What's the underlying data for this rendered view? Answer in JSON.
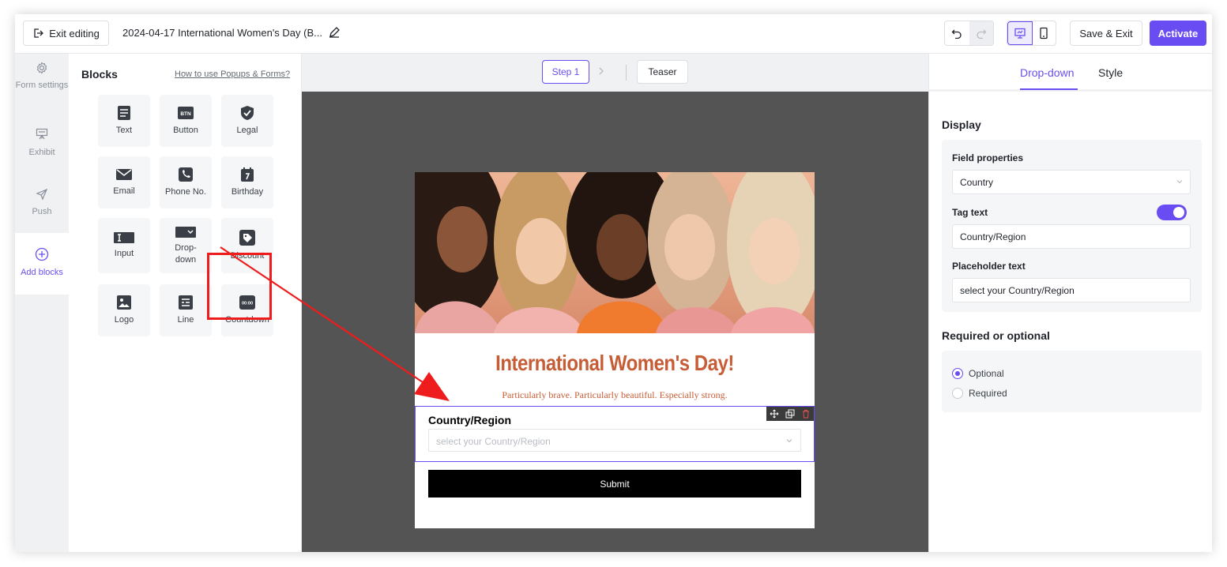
{
  "topbar": {
    "exit_label": "Exit editing",
    "title": "2024-04-17 International Women's Day (B...",
    "save_label": "Save & Exit",
    "activate_label": "Activate"
  },
  "rail": {
    "form_settings": "Form settings",
    "exhibit": "Exhibit",
    "push": "Push",
    "add_blocks": "Add blocks"
  },
  "blocks": {
    "title": "Blocks",
    "help_link": "How to use Popups & Forms?",
    "items": [
      {
        "label": "Text",
        "icon": "text-icon"
      },
      {
        "label": "Button",
        "icon": "button-icon"
      },
      {
        "label": "Legal",
        "icon": "shield-icon"
      },
      {
        "label": "Email",
        "icon": "email-icon"
      },
      {
        "label": "Phone No.",
        "icon": "phone-icon"
      },
      {
        "label": "Birthday",
        "icon": "calendar-icon"
      },
      {
        "label": "Input",
        "icon": "input-icon"
      },
      {
        "label": "Drop-down",
        "icon": "dropdown-icon"
      },
      {
        "label": "Discount",
        "icon": "tag-icon"
      },
      {
        "label": "Logo",
        "icon": "image-icon"
      },
      {
        "label": "Line",
        "icon": "line-icon"
      },
      {
        "label": "Countdown",
        "icon": "countdown-icon"
      }
    ],
    "button_icon_text": "BTN",
    "countdown_icon_text": "00:00"
  },
  "canvas": {
    "step_label": "Step 1",
    "teaser_label": "Teaser",
    "headline": "International Women's Day!",
    "subline": "Particularly brave. Particularly beautiful. Especially strong.",
    "dropdown_label": "Country/Region",
    "dropdown_placeholder": "select your Country/Region",
    "submit_label": "Submit"
  },
  "right": {
    "tab_dropdown": "Drop-down",
    "tab_style": "Style",
    "display_title": "Display",
    "field_properties_label": "Field properties",
    "field_properties_value": "Country",
    "tag_text_label": "Tag text",
    "tag_text_value": "Country/Region",
    "tag_text_enabled": true,
    "placeholder_label": "Placeholder text",
    "placeholder_value": "select your Country/Region",
    "required_title": "Required or optional",
    "optional_label": "Optional",
    "required_label": "Required",
    "selected": "Optional"
  },
  "colors": {
    "accent": "#6a4df2",
    "headline": "#c65d36",
    "highlight": "#ee1c1c"
  }
}
